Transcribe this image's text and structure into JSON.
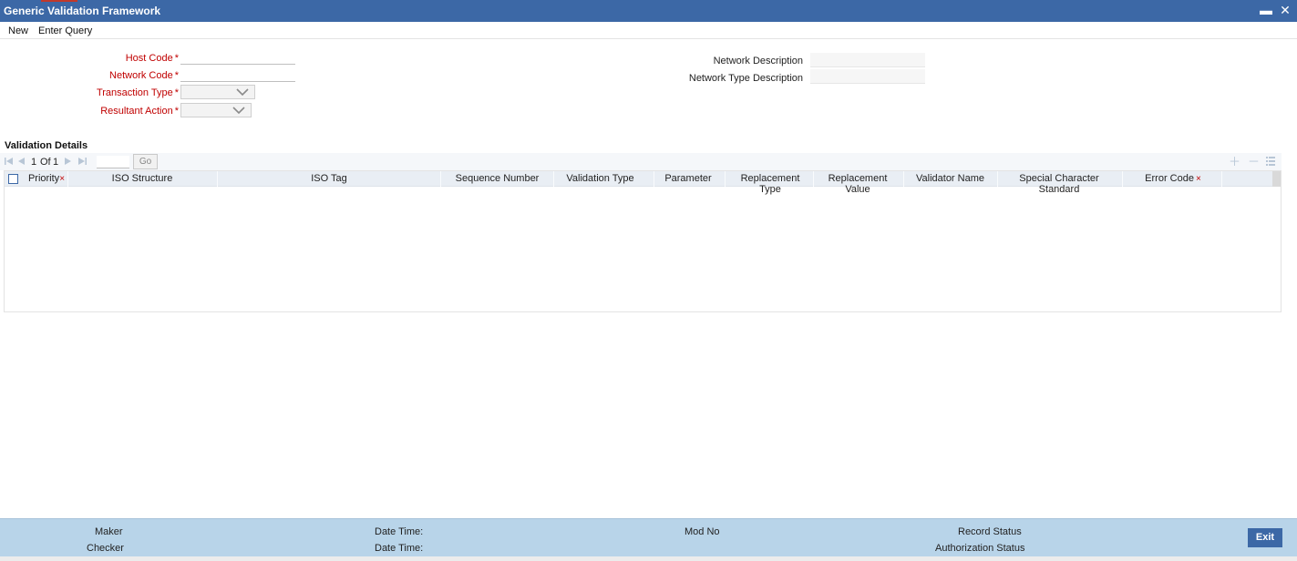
{
  "window": {
    "title": "Generic Validation Framework",
    "minimize_glyph": "▬",
    "close_glyph": "✕"
  },
  "menu": {
    "new_label": "New",
    "enter_query_label": "Enter Query"
  },
  "form": {
    "host_code_label": "Host Code",
    "network_code_label": "Network Code",
    "transaction_type_label": "Transaction Type",
    "resultant_action_label": "Resultant Action",
    "network_description_label": "Network Description",
    "network_type_description_label": "Network Type Description",
    "required_mark": "*",
    "host_code_value": "",
    "network_code_value": ""
  },
  "validation_details": {
    "title": "Validation Details",
    "pager": {
      "current": "1",
      "of_label": "Of",
      "total": "1",
      "go_label": "Go"
    },
    "columns": [
      {
        "label": "Priority",
        "required": true
      },
      {
        "label": "ISO Structure",
        "required": false
      },
      {
        "label": "ISO Tag",
        "required": false
      },
      {
        "label": "Sequence Number",
        "required": false
      },
      {
        "label": "Validation Type",
        "required": false
      },
      {
        "label": "Parameter",
        "required": false
      },
      {
        "label": "Replacement Type",
        "required": false
      },
      {
        "label": "Replacement Value",
        "required": false
      },
      {
        "label": "Validator Name",
        "required": false
      },
      {
        "label": "Special Character Standard",
        "required": false
      },
      {
        "label": "Error Code",
        "required": true
      }
    ],
    "column_required_mark": "×",
    "rows": []
  },
  "footer": {
    "maker_label": "Maker",
    "checker_label": "Checker",
    "date_time_label_1": "Date Time:",
    "date_time_label_2": "Date Time:",
    "mod_no_label": "Mod No",
    "record_status_label": "Record Status",
    "authorization_status_label": "Authorization Status",
    "exit_label": "Exit"
  },
  "colors": {
    "title_bar": "#3c68a6",
    "required_label": "#c00000",
    "footer_bg": "#b8d4e9",
    "grid_header": "#e9eef4"
  }
}
